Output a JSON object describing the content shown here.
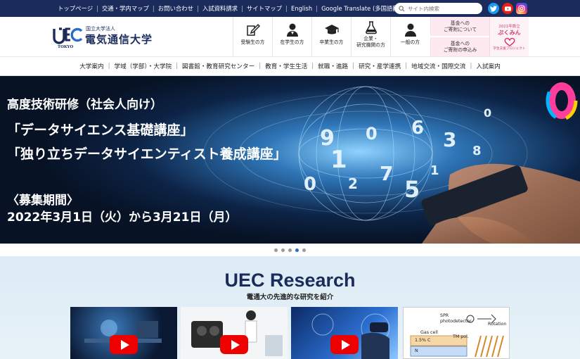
{
  "topbar": {
    "links": [
      "トップページ",
      "交通・学内マップ",
      "お問い合わせ",
      "入試資料請求",
      "サイトマップ",
      "English",
      "Google Translate (多国語翻訳)"
    ],
    "search_placeholder": "サイト内検索",
    "social": [
      "twitter-icon",
      "youtube-icon",
      "instagram-icon"
    ]
  },
  "header": {
    "logo_top": "国立大学法人",
    "logo_name": "電気通信大学",
    "logo_mark": "UEC",
    "logo_sub": "TOKYO",
    "audience": [
      {
        "label": "受験生の方",
        "icon": "pen-paper-icon"
      },
      {
        "label": "在学生の方",
        "icon": "student-icon"
      },
      {
        "label": "卒業生の方",
        "icon": "graduation-cap-icon"
      },
      {
        "label": "企業・\n研究機関の方",
        "icon": "flask-icon"
      },
      {
        "label": "一般の方",
        "icon": "person-icon"
      }
    ],
    "donate_1": "基金への\nご寄附について",
    "donate_2": "基金への\nご寄附の申込み",
    "badge_year": "2021年設立",
    "badge_name": "ぷくみん",
    "badge_sub": "学生支援プロジェクト"
  },
  "menu": [
    "大学案内",
    "学域（学部）・大学院",
    "図書館・教育研究センター",
    "教育・学生生活",
    "就職・進路",
    "研究・産学連携",
    "地域交流・国際交流",
    "入試案内"
  ],
  "hero": {
    "line1": "高度技術研修（社会人向け）",
    "line2": "「データサイエンス基礎講座」",
    "line3": "「独り立ちデータサイエンティスト養成講座」",
    "line4": "〈募集期間〉",
    "line5": "2022年3月1日（火）から3月21日（月）",
    "numbers": [
      "9",
      "0",
      "1",
      "6",
      "3",
      "2",
      "8",
      "7",
      "5",
      "0",
      "0",
      "1"
    ],
    "slides": 5,
    "active_slide": 3
  },
  "research": {
    "title": "UEC Research",
    "subtitle": "電通大の先進的な研究を紹介",
    "thumb4_label1": "SPR",
    "thumb4_label2": "photodetector",
    "thumb4_label3": "Gas cell",
    "thumb4_label4": "1.5% C",
    "thumb4_label5": "N",
    "thumb4_label6": "TM pol.",
    "thumb4_label7": "Rotation"
  },
  "colors": {
    "navy": "#1b2b5c",
    "accent": "#2a6ac8",
    "youtube": "#ee0000"
  }
}
